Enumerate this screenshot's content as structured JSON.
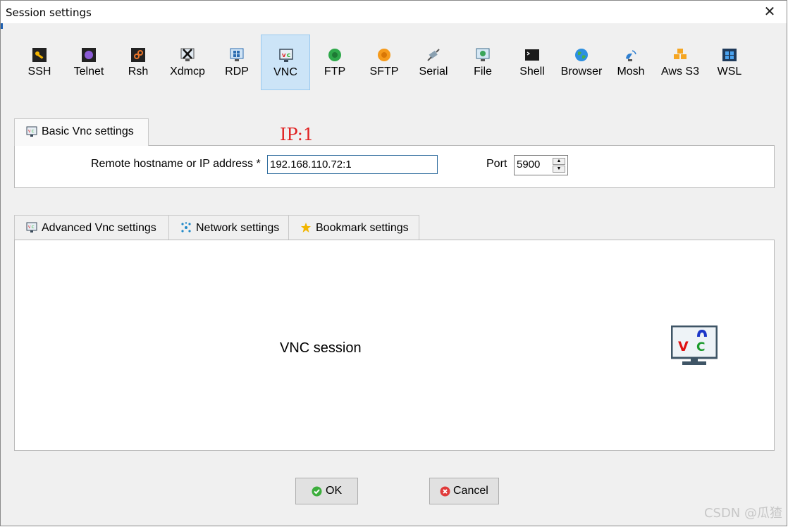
{
  "window": {
    "title": "Session settings",
    "close_glyph": "✕"
  },
  "session_types": [
    {
      "label": "SSH",
      "icon": "ssh-key-icon"
    },
    {
      "label": "Telnet",
      "icon": "telnet-icon"
    },
    {
      "label": "Rsh",
      "icon": "rsh-icon"
    },
    {
      "label": "Xdmcp",
      "icon": "xdmcp-icon"
    },
    {
      "label": "RDP",
      "icon": "rdp-icon"
    },
    {
      "label": "VNC",
      "icon": "vnc-icon",
      "active": true
    },
    {
      "label": "FTP",
      "icon": "ftp-icon"
    },
    {
      "label": "SFTP",
      "icon": "sftp-icon"
    },
    {
      "label": "Serial",
      "icon": "serial-icon"
    },
    {
      "label": "File",
      "icon": "file-icon"
    },
    {
      "label": "Shell",
      "icon": "shell-icon"
    },
    {
      "label": "Browser",
      "icon": "browser-icon"
    },
    {
      "label": "Mosh",
      "icon": "mosh-icon"
    },
    {
      "label": "Aws S3",
      "icon": "aws-s3-icon"
    },
    {
      "label": "WSL",
      "icon": "wsl-icon"
    }
  ],
  "basic_tab": {
    "label": "Basic Vnc settings",
    "hostname_label": "Remote hostname or IP address *",
    "hostname_value": "192.168.110.72:1",
    "port_label": "Port",
    "port_value": "5900",
    "annotation": "IP:1"
  },
  "lower_tabs": {
    "advanced": "Advanced Vnc settings",
    "network": "Network settings",
    "bookmark": "Bookmark settings"
  },
  "session_caption": "VNC session",
  "buttons": {
    "ok": "OK",
    "cancel": "Cancel"
  },
  "watermark": "CSDN @瓜猹",
  "colors": {
    "active_tab_bg": "#cce4f7",
    "input_border": "#2f6c9e",
    "annotation": "#e02020"
  }
}
